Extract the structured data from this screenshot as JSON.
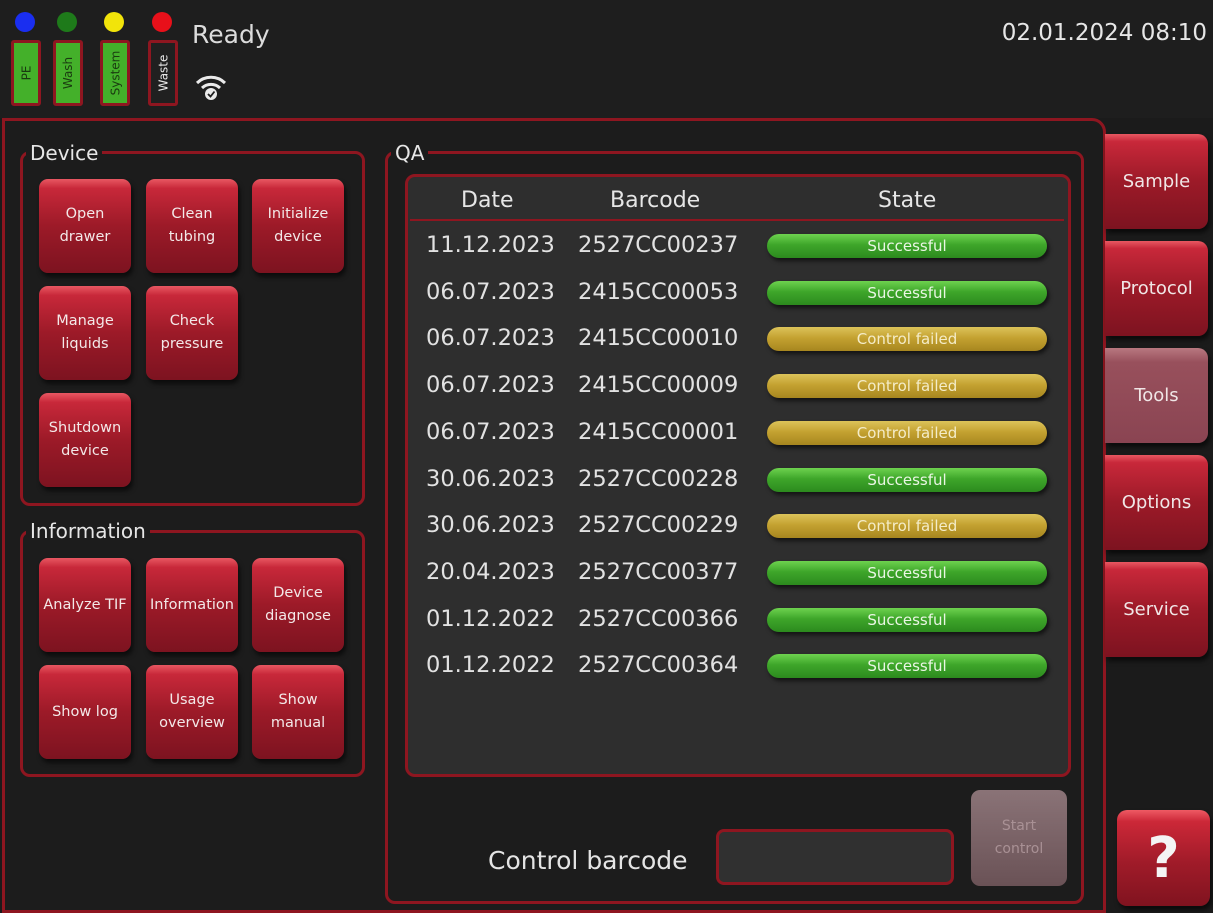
{
  "header": {
    "status": "Ready",
    "datetime": "02.01.2024 08:10",
    "indicators": [
      {
        "color": "#1a2ef0"
      },
      {
        "color": "#1e7a1a"
      },
      {
        "color": "#f2e40a"
      },
      {
        "color": "#e8101a"
      }
    ],
    "tanks": [
      {
        "label": "PE",
        "state": "full"
      },
      {
        "label": "Wash",
        "state": "full"
      },
      {
        "label": "System",
        "state": "full"
      },
      {
        "label": "Waste",
        "state": "empty"
      }
    ],
    "wifi_icon": "wifi-connected-icon"
  },
  "device": {
    "title": "Device",
    "buttons": [
      "Open\ndrawer",
      "Clean\ntubing",
      "Initialize\ndevice",
      "Manage\nliquids",
      "Check\npressure",
      "Shutdown\ndevice"
    ]
  },
  "information": {
    "title": "Information",
    "buttons": [
      "Analyze TIF",
      "Information",
      "Device\ndiagnose",
      "Show log",
      "Usage\noverview",
      "Show\nmanual"
    ]
  },
  "qa": {
    "title": "QA",
    "columns": [
      "Date",
      "Barcode",
      "State"
    ],
    "rows": [
      {
        "date": "11.12.2023",
        "barcode": "2527CC00237",
        "state": "Successful"
      },
      {
        "date": "06.07.2023",
        "barcode": "2415CC00053",
        "state": "Successful"
      },
      {
        "date": "06.07.2023",
        "barcode": "2415CC00010",
        "state": "Control failed"
      },
      {
        "date": "06.07.2023",
        "barcode": "2415CC00009",
        "state": "Control failed"
      },
      {
        "date": "06.07.2023",
        "barcode": "2415CC00001",
        "state": "Control failed"
      },
      {
        "date": "30.06.2023",
        "barcode": "2527CC00228",
        "state": "Successful"
      },
      {
        "date": "30.06.2023",
        "barcode": "2527CC00229",
        "state": "Control failed"
      },
      {
        "date": "20.04.2023",
        "barcode": "2527CC00377",
        "state": "Successful"
      },
      {
        "date": "01.12.2022",
        "barcode": "2527CC00366",
        "state": "Successful"
      },
      {
        "date": "01.12.2022",
        "barcode": "2527CC00364",
        "state": "Successful"
      }
    ],
    "control_label": "Control barcode",
    "control_value": "",
    "start_label": "Start\ncontrol"
  },
  "tabs": [
    {
      "label": "Sample",
      "active": false
    },
    {
      "label": "Protocol",
      "active": false
    },
    {
      "label": "Tools",
      "active": true
    },
    {
      "label": "Options",
      "active": false
    },
    {
      "label": "Service",
      "active": false
    }
  ],
  "help_label": "?",
  "colors": {
    "accent": "#8e1620",
    "success": "#3ea62a",
    "failed": "#c4a231"
  }
}
